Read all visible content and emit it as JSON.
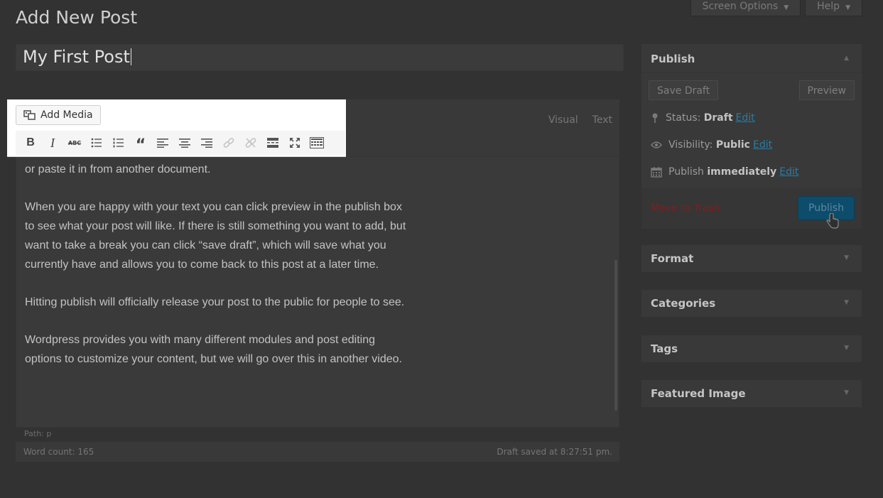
{
  "header": {
    "page_title": "Add New Post",
    "screen_options_label": "Screen Options",
    "help_label": "Help"
  },
  "post": {
    "title_value": "My First Post"
  },
  "editor": {
    "add_media_label": "Add Media",
    "tabs": [
      "Visual",
      "Text"
    ],
    "toolbar_icons": [
      "bold-icon",
      "italic-icon",
      "strikethrough-icon",
      "bullet-list-icon",
      "numbered-list-icon",
      "blockquote-icon",
      "align-left-icon",
      "align-center-icon",
      "align-right-icon",
      "insert-link-icon",
      "remove-link-icon",
      "read-more-icon",
      "fullscreen-icon",
      "toolbar-toggle-icon"
    ],
    "paragraphs": [
      "or paste it in from another document.",
      "When you are happy with your text you can click preview in the publish box to see what your post will like. If there is still something you want to add, but want to take a break you can click “save draft”, which will save what you currently have and allows you to come back to this post at a later time.",
      "Hitting publish will officially release your post to the public for people to see.",
      "Wordpress provides you with many different modules and post editing options to customize your content, but we will go over this in another video."
    ],
    "path_label": "Path: p",
    "word_count": "Word count: 165",
    "draft_saved": "Draft saved at 8:27:51 pm."
  },
  "publish_box": {
    "title": "Publish",
    "save_draft_label": "Save Draft",
    "preview_label": "Preview",
    "status_label": "Status:",
    "status_value": "Draft",
    "visibility_label": "Visibility:",
    "visibility_value": "Public",
    "publish_label": "Publish",
    "publish_value": "immediately",
    "edit_label": "Edit",
    "trash_label": "Move to Trash",
    "publish_button_label": "Publish"
  },
  "sidebar_boxes": {
    "format": "Format",
    "categories": "Categories",
    "tags": "Tags",
    "featured_image": "Featured Image"
  },
  "colors": {
    "overlay_bg": "#323232",
    "link": "#2a7ca5",
    "trash": "#7f1f1f",
    "publish_button": "#0d4c6a"
  }
}
